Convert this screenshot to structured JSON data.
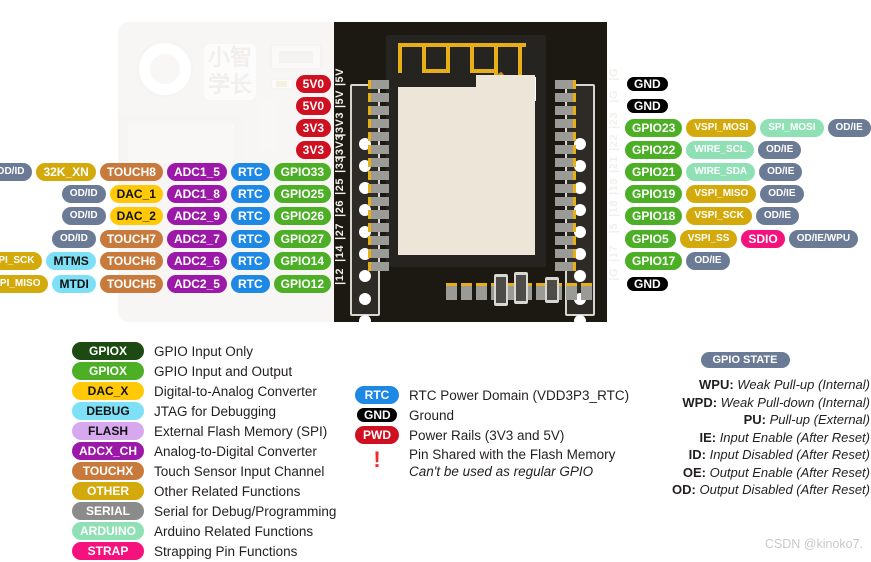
{
  "watermark": "CSDN @kinoko7.",
  "board": {
    "logo_text": "小智\n学长",
    "left_pin_numbers": [
      "5V",
      "5V",
      "3V3",
      "3V3",
      "33",
      "25",
      "26",
      "27",
      "14",
      "12"
    ],
    "right_pin_numbers": [
      "G",
      "G",
      "23",
      "22",
      "21",
      "19",
      "18",
      "5",
      "17",
      "G"
    ]
  },
  "colors": {
    "gpio_in_only": "#1d4a12",
    "gpio_io": "#4caf26",
    "dac": "#ffc907",
    "debug": "#7ee0f7",
    "flash": "#d8a8ef",
    "adc": "#9b18a8",
    "touch": "#c87a3c",
    "other": "#d4a90c",
    "serial": "#8b8b8b",
    "arduino": "#8fe0b4",
    "strap": "#f5127d",
    "state": "#6c7b95",
    "rtc": "#1e88e5",
    "gnd": "#000000",
    "pwd": "#cf1020"
  },
  "power_rows": [
    {
      "label": "5V0"
    },
    {
      "label": "5V0"
    },
    {
      "label": "3V3"
    },
    {
      "label": "3V3"
    }
  ],
  "left_rows": [
    {
      "pins": [
        {
          "text": "OD/ID",
          "kind": "state",
          "size": "sm"
        },
        {
          "text": "32K_XN",
          "kind": "other"
        },
        {
          "text": "TOUCH8",
          "kind": "touch"
        },
        {
          "text": "ADC1_5",
          "kind": "adc"
        },
        {
          "text": "RTC",
          "kind": "rtc"
        },
        {
          "text": "GPIO33",
          "kind": "gpio_io"
        }
      ]
    },
    {
      "pins": [
        {
          "text": "OD/ID",
          "kind": "state",
          "size": "sm"
        },
        {
          "text": "DAC_1",
          "kind": "dac"
        },
        {
          "text": "ADC1_8",
          "kind": "adc"
        },
        {
          "text": "RTC",
          "kind": "rtc"
        },
        {
          "text": "GPIO25",
          "kind": "gpio_io"
        }
      ]
    },
    {
      "pins": [
        {
          "text": "OD/ID",
          "kind": "state",
          "size": "sm"
        },
        {
          "text": "DAC_2",
          "kind": "dac"
        },
        {
          "text": "ADC2_9",
          "kind": "adc"
        },
        {
          "text": "RTC",
          "kind": "rtc"
        },
        {
          "text": "GPIO26",
          "kind": "gpio_io"
        }
      ]
    },
    {
      "pins": [
        {
          "text": "OD/ID",
          "kind": "state",
          "size": "sm"
        },
        {
          "text": "TOUCH7",
          "kind": "touch"
        },
        {
          "text": "ADC2_7",
          "kind": "adc"
        },
        {
          "text": "RTC",
          "kind": "rtc"
        },
        {
          "text": "GPIO27",
          "kind": "gpio_io"
        }
      ]
    },
    {
      "pins": [
        {
          "text": "HSPI_SCK",
          "kind": "other",
          "size": "sm"
        },
        {
          "text": "MTMS",
          "kind": "debug"
        },
        {
          "text": "TOUCH6",
          "kind": "touch"
        },
        {
          "text": "ADC2_6",
          "kind": "adc"
        },
        {
          "text": "RTC",
          "kind": "rtc"
        },
        {
          "text": "GPIO14",
          "kind": "gpio_io"
        }
      ]
    },
    {
      "pins": [
        {
          "text": "HSPI_MISO",
          "kind": "other",
          "size": "sm"
        },
        {
          "text": "MTDI",
          "kind": "debug"
        },
        {
          "text": "TOUCH5",
          "kind": "touch"
        },
        {
          "text": "ADC2_5",
          "kind": "adc"
        },
        {
          "text": "RTC",
          "kind": "rtc"
        },
        {
          "text": "GPIO12",
          "kind": "gpio_io"
        }
      ]
    }
  ],
  "right_rows": [
    {
      "pins": [
        {
          "text": "GND",
          "kind": "gnd"
        }
      ]
    },
    {
      "pins": [
        {
          "text": "GND",
          "kind": "gnd"
        }
      ]
    },
    {
      "pins": [
        {
          "text": "GPIO23",
          "kind": "gpio_io"
        },
        {
          "text": "VSPI_MOSI",
          "kind": "other",
          "size": "sm"
        },
        {
          "text": "SPI_MOSI",
          "kind": "arduino",
          "size": "sm"
        },
        {
          "text": "OD/IE",
          "kind": "state",
          "size": "sm"
        }
      ]
    },
    {
      "pins": [
        {
          "text": "GPIO22",
          "kind": "gpio_io"
        },
        {
          "text": "WIRE_SCL",
          "kind": "arduino",
          "size": "sm"
        },
        {
          "text": "OD/IE",
          "kind": "state",
          "size": "sm"
        }
      ]
    },
    {
      "pins": [
        {
          "text": "GPIO21",
          "kind": "gpio_io"
        },
        {
          "text": "WIRE_SDA",
          "kind": "arduino",
          "size": "sm"
        },
        {
          "text": "OD/IE",
          "kind": "state",
          "size": "sm"
        }
      ]
    },
    {
      "pins": [
        {
          "text": "GPIO19",
          "kind": "gpio_io"
        },
        {
          "text": "VSPI_MISO",
          "kind": "other",
          "size": "sm"
        },
        {
          "text": "OD/IE",
          "kind": "state",
          "size": "sm"
        }
      ]
    },
    {
      "pins": [
        {
          "text": "GPIO18",
          "kind": "gpio_io"
        },
        {
          "text": "VSPI_SCK",
          "kind": "other",
          "size": "sm"
        },
        {
          "text": "OD/IE",
          "kind": "state",
          "size": "sm"
        }
      ]
    },
    {
      "pins": [
        {
          "text": "GPIO5",
          "kind": "gpio_io"
        },
        {
          "text": "VSPI_SS",
          "kind": "other",
          "size": "sm"
        },
        {
          "text": "SDIO",
          "kind": "strap"
        },
        {
          "text": "OD/IE/WPU",
          "kind": "state",
          "size": "sm"
        }
      ]
    },
    {
      "pins": [
        {
          "text": "GPIO17",
          "kind": "gpio_io"
        },
        {
          "text": "OD/IE",
          "kind": "state",
          "size": "sm"
        }
      ]
    },
    {
      "pins": [
        {
          "text": "GND",
          "kind": "gnd"
        }
      ]
    }
  ],
  "legend_left": [
    {
      "badge": "GPIOX",
      "kind": "gpio_in_only",
      "desc": "GPIO Input Only"
    },
    {
      "badge": "GPIOX",
      "kind": "gpio_io",
      "desc": "GPIO Input and Output"
    },
    {
      "badge": "DAC_X",
      "kind": "dac",
      "desc": "Digital-to-Analog Converter"
    },
    {
      "badge": "DEBUG",
      "kind": "debug",
      "desc": "JTAG for Debugging"
    },
    {
      "badge": "FLASH",
      "kind": "flash",
      "desc": "External Flash Memory (SPI)"
    },
    {
      "badge": "ADCX_CH",
      "kind": "adc",
      "desc": "Analog-to-Digital Converter"
    },
    {
      "badge": "TOUCHX",
      "kind": "touch",
      "desc": "Touch Sensor Input Channel"
    },
    {
      "badge": "OTHER",
      "kind": "other",
      "desc": "Other Related Functions"
    },
    {
      "badge": "SERIAL",
      "kind": "serial",
      "desc": "Serial for Debug/Programming"
    },
    {
      "badge": "ARDUINO",
      "kind": "arduino",
      "desc": "Arduino Related Functions"
    },
    {
      "badge": "STRAP",
      "kind": "strap",
      "desc": "Strapping Pin Functions"
    }
  ],
  "legend_mid": [
    {
      "badge": "RTC",
      "kind": "rtc",
      "desc": "RTC Power Domain (VDD3P3_RTC)"
    },
    {
      "badge": "GND",
      "kind": "gnd",
      "desc": "Ground"
    },
    {
      "badge": "PWD",
      "kind": "pwd",
      "desc": "Power Rails (3V3 and 5V)"
    }
  ],
  "legend_warning": {
    "symbol": "!",
    "line1": "Pin Shared with the Flash Memory",
    "line2": "Can't be used as regular GPIO"
  },
  "gpio_state": {
    "title": "GPIO STATE",
    "items": [
      {
        "abbr": "WPU",
        "desc": "Weak Pull-up (Internal)"
      },
      {
        "abbr": "WPD",
        "desc": "Weak Pull-down (Internal)"
      },
      {
        "abbr": "PU",
        "desc": "Pull-up (External)"
      },
      {
        "abbr": "IE",
        "desc": "Input Enable (After Reset)"
      },
      {
        "abbr": "ID",
        "desc": "Input Disabled (After Reset)"
      },
      {
        "abbr": "OE",
        "desc": "Output Enable (After Reset)"
      },
      {
        "abbr": "OD",
        "desc": "Output Disabled (After Reset)"
      }
    ]
  }
}
